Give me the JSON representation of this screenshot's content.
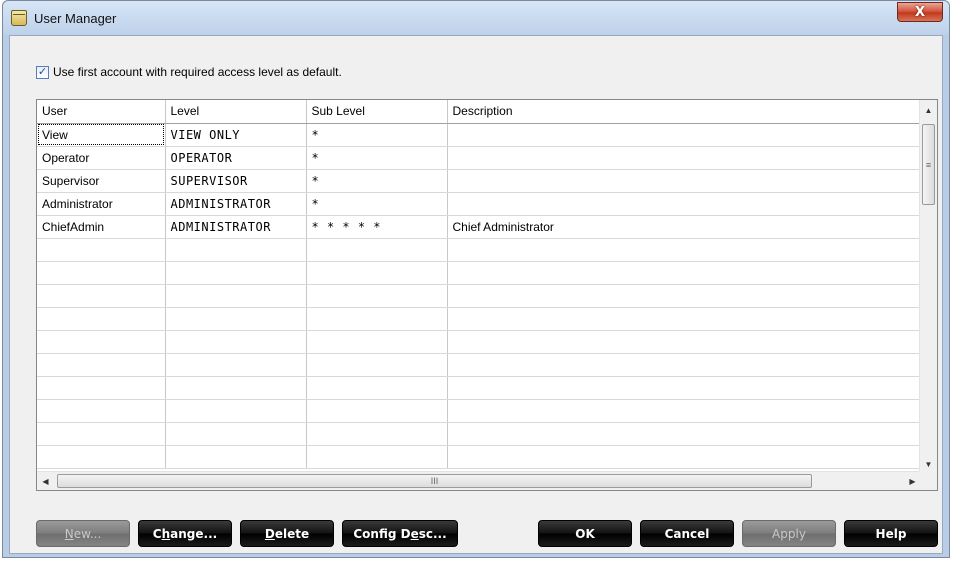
{
  "window": {
    "title": "User Manager",
    "close_label": "X"
  },
  "checkbox": {
    "checked": true,
    "mark": "✓",
    "label": "Use first account with required access level as default."
  },
  "table": {
    "columns": [
      "User",
      "Level",
      "Sub Level",
      "Description"
    ],
    "rows": [
      [
        "View",
        "VIEW ONLY",
        "*",
        ""
      ],
      [
        "Operator",
        "OPERATOR",
        "*",
        ""
      ],
      [
        "Supervisor",
        "SUPERVISOR",
        "*",
        ""
      ],
      [
        "Administrator",
        "ADMINISTRATOR",
        "*",
        ""
      ],
      [
        "ChiefAdmin",
        "ADMINISTRATOR",
        "* * * * *",
        "Chief Administrator"
      ],
      [
        "",
        "",
        "",
        ""
      ],
      [
        "",
        "",
        "",
        ""
      ],
      [
        "",
        "",
        "",
        ""
      ],
      [
        "",
        "",
        "",
        ""
      ],
      [
        "",
        "",
        "",
        ""
      ],
      [
        "",
        "",
        "",
        ""
      ],
      [
        "",
        "",
        "",
        ""
      ],
      [
        "",
        "",
        "",
        ""
      ],
      [
        "",
        "",
        "",
        ""
      ],
      [
        "",
        "",
        "",
        ""
      ]
    ]
  },
  "scrollbars": {
    "up_arrow": "▲",
    "down_arrow": "▼",
    "left_arrow": "◀",
    "right_arrow": "▶",
    "v_grip": "≡",
    "h_grip": "III"
  },
  "buttons": {
    "new": {
      "label": "New...",
      "accesskey": "N",
      "enabled": false
    },
    "change": {
      "label": "Change...",
      "accesskey": "h",
      "enabled": true
    },
    "delete": {
      "label": "Delete",
      "accesskey": "D",
      "enabled": true
    },
    "config_desc": {
      "label": "Config Desc...",
      "accesskey": "e",
      "enabled": true
    },
    "ok": {
      "label": "OK",
      "enabled": true
    },
    "cancel": {
      "label": "Cancel",
      "enabled": true
    },
    "apply": {
      "label": "Apply",
      "enabled": false
    },
    "help": {
      "label": "Help",
      "enabled": true
    }
  }
}
